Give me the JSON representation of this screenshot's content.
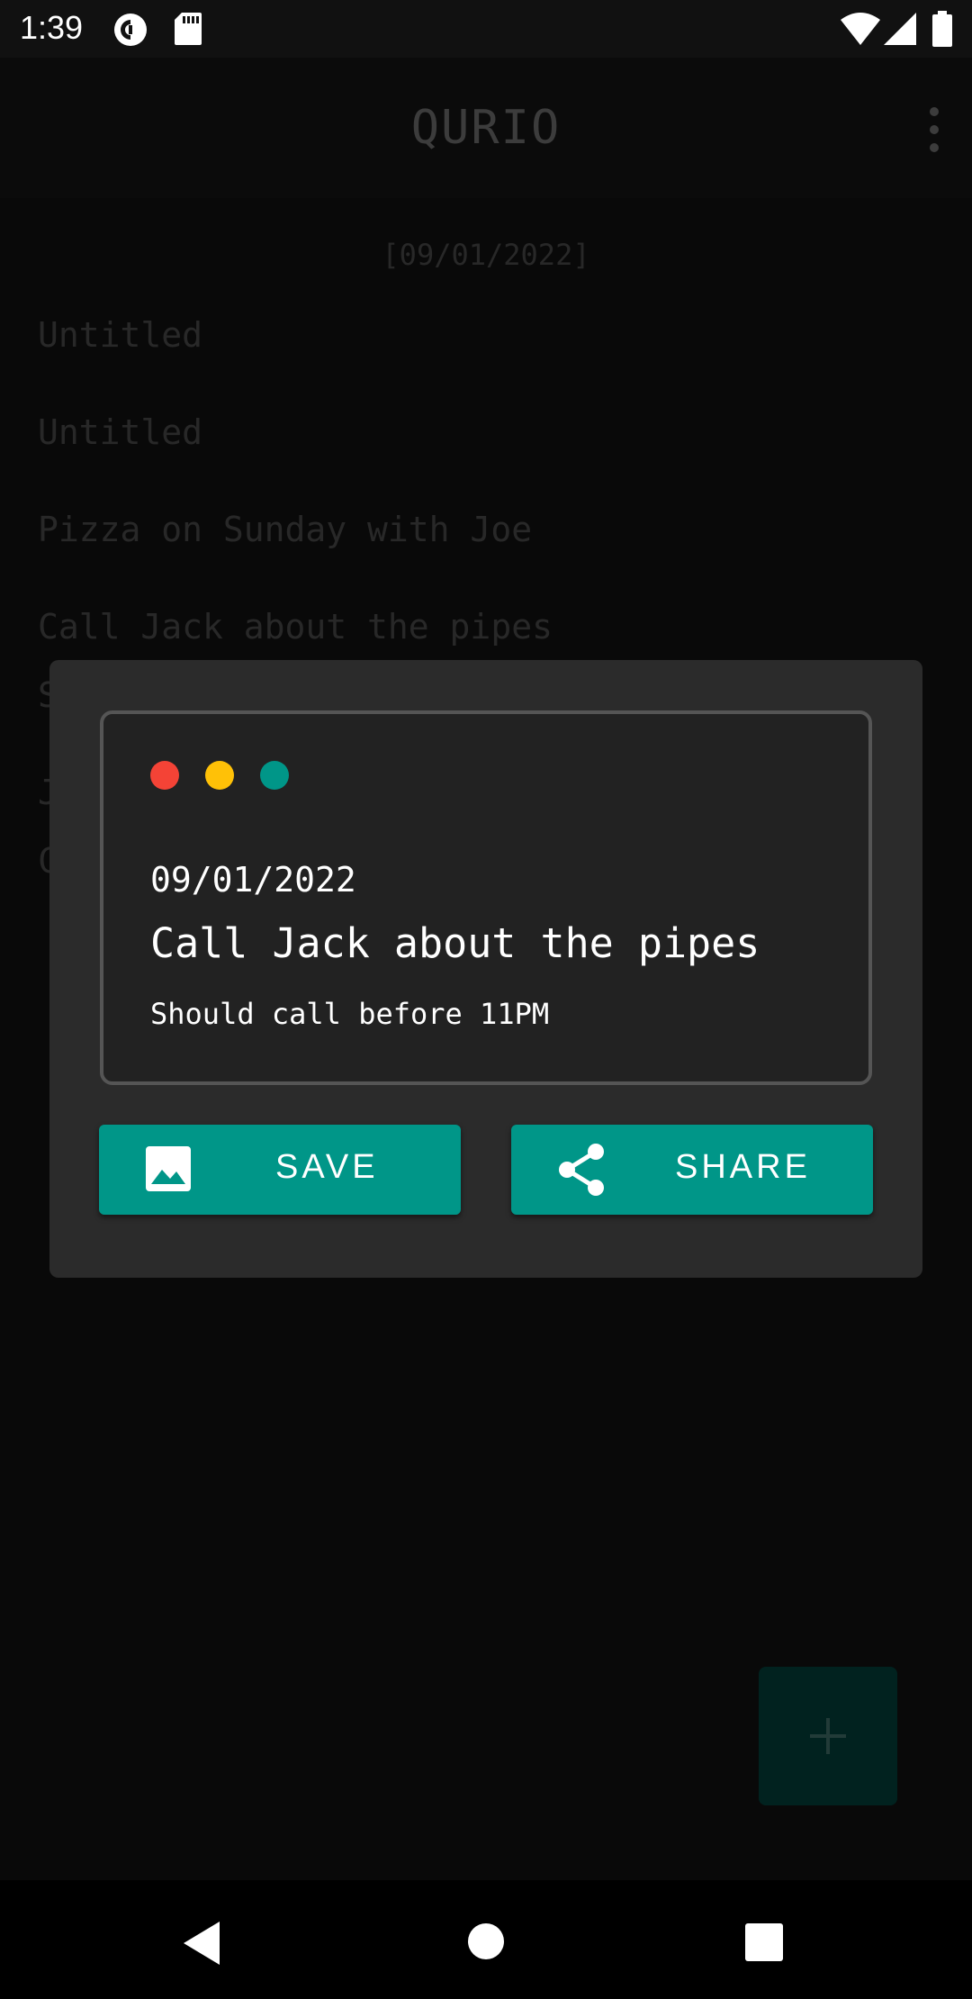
{
  "status_bar": {
    "time": "1:39",
    "left_icons": [
      "pocketcasts-icon",
      "sd-card-icon"
    ],
    "right_icons": [
      "wifi-icon",
      "signal-icon",
      "battery-icon"
    ]
  },
  "app_bar": {
    "title": "QURIO",
    "menu_icon": "more-vert-icon"
  },
  "notes_list": {
    "date_header": "[09/01/2022]",
    "items": [
      "Untitled",
      "Untitled",
      "Pizza on Sunday with Joe",
      "Call Jack about the pipes",
      "S",
      "J",
      "C"
    ]
  },
  "dialog": {
    "card": {
      "dot_colors": [
        "#f44336",
        "#ffc107",
        "#009688"
      ],
      "date": "09/01/2022",
      "title": "Call Jack about the pipes",
      "body": "Should call before 11PM"
    },
    "save_label": "SAVE",
    "share_label": "SHARE"
  },
  "fab": {
    "icon": "plus-icon"
  },
  "nav_bar": {
    "icons": [
      "back-icon",
      "home-icon",
      "recents-icon"
    ]
  },
  "colors": {
    "accent": "#009688",
    "background": "#111111",
    "dialog": "#2b2b2b"
  }
}
